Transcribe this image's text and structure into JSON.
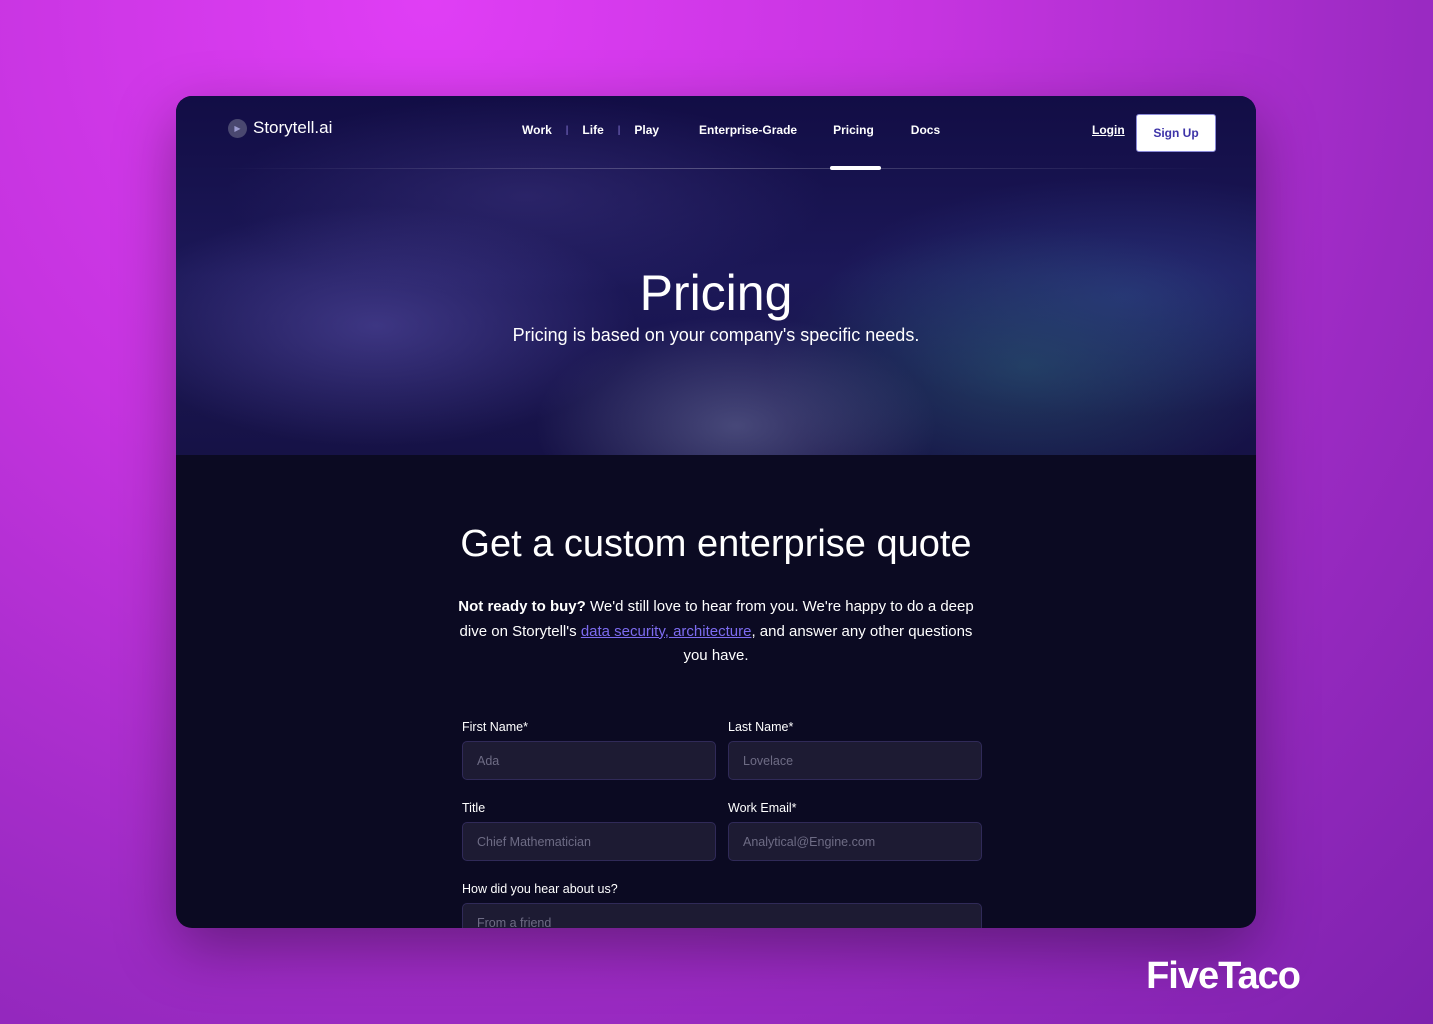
{
  "nav": {
    "logo": "Storytell.ai",
    "items": [
      "Work",
      "Life",
      "Play",
      "Enterprise-Grade",
      "Pricing",
      "Docs"
    ],
    "separator": "|",
    "login": "Login",
    "signup": "Sign Up",
    "active": "Pricing"
  },
  "hero": {
    "title": "Pricing",
    "subtitle": "Pricing is based on your company's specific needs."
  },
  "quote": {
    "title": "Get a custom enterprise quote",
    "intro_bold": "Not ready to buy?",
    "intro_1": " We'd still love to hear from you. We're happy to do a deep dive on Storytell's ",
    "link": "data security, architecture",
    "intro_2": ", and answer any other questions you have."
  },
  "form": {
    "first_name": {
      "label": "First Name*",
      "placeholder": "Ada"
    },
    "last_name": {
      "label": "Last Name*",
      "placeholder": "Lovelace"
    },
    "title": {
      "label": "Title",
      "placeholder": "Chief Mathematician"
    },
    "email": {
      "label": "Work Email*",
      "placeholder": "Analytical@Engine.com"
    },
    "source": {
      "label": "How did you hear about us?",
      "placeholder": "From a friend"
    }
  },
  "watermark": "FiveTaco"
}
